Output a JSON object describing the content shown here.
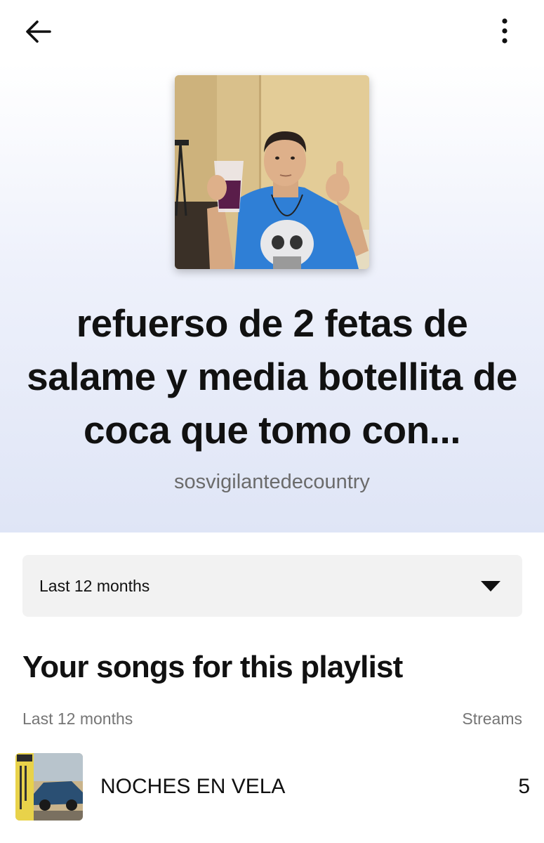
{
  "nav": {
    "back_icon": "arrow-left-icon",
    "more_icon": "more-vertical-icon"
  },
  "playlist": {
    "title": "refuerso de 2 fetas de salame y media botellita de coca que tomo con...",
    "owner": "sosvigilantedecountry",
    "cover_description_icon": "playlist-cover-photo"
  },
  "filter": {
    "selected": "Last 12 months",
    "dropdown_icon": "caret-down-icon"
  },
  "songs_section": {
    "title": "Your songs for this playlist",
    "period_label": "Last 12 months",
    "streams_label": "Streams",
    "songs": [
      {
        "title": "NOCHES EN VELA",
        "streams": "5",
        "art_icon": "album-cover"
      }
    ]
  },
  "colors": {
    "gradient_top": "#ffffff",
    "gradient_bottom": "#dfe5f6",
    "select_bg": "#f2f2f2",
    "muted_text": "#6b6b6b"
  }
}
